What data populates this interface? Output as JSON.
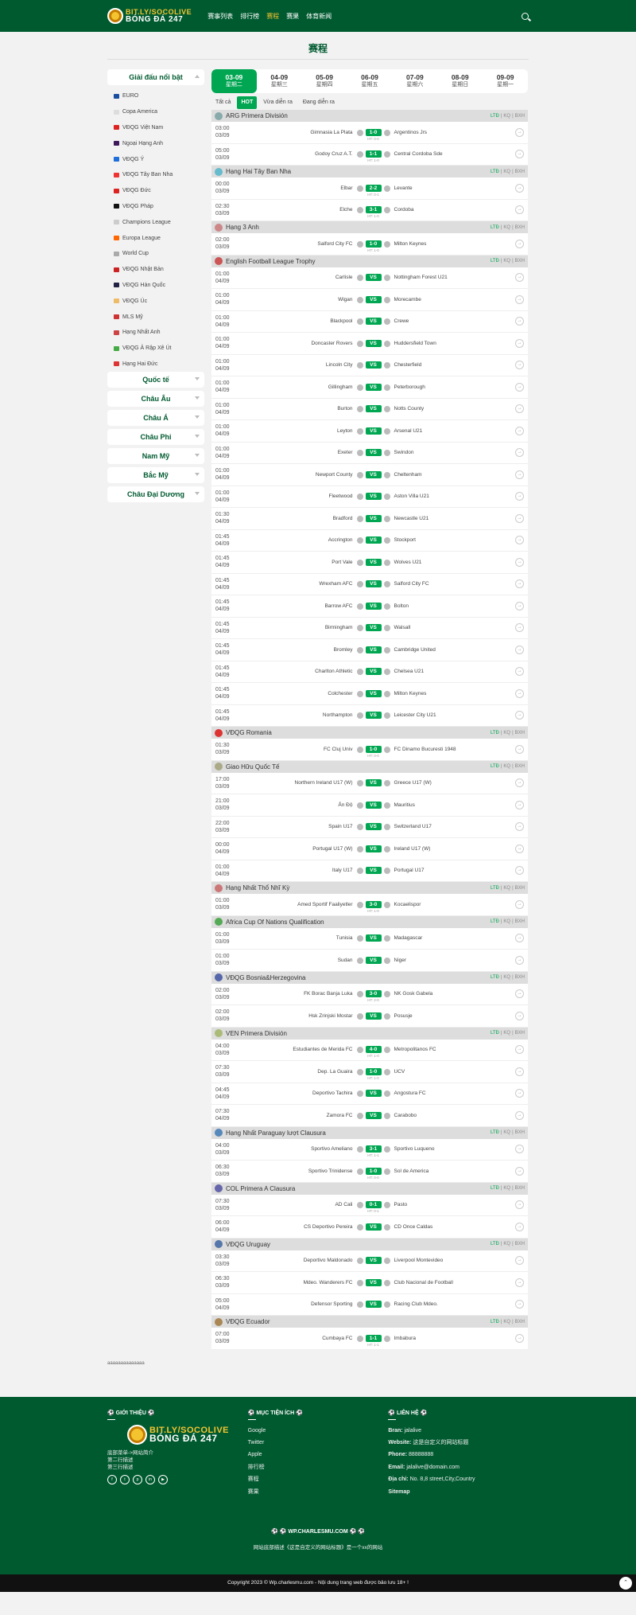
{
  "header": {
    "logo_top": "BIT.LY/SOCOLIVE",
    "logo_bottom": "BÓNG ĐÁ 247",
    "nav": [
      "赛事列表",
      "排行榜",
      "赛程",
      "赛果",
      "体育新闻"
    ],
    "nav_active": 2
  },
  "page_title": "赛程",
  "sidebar": {
    "featured_title": "Giải đấu nổi bật",
    "leagues": [
      "EURO",
      "Copa America",
      "VĐQG Việt Nam",
      "Ngoại Hạng Anh",
      "VĐQG Ý",
      "VĐQG Tây Ban Nha",
      "VĐQG Đức",
      "VĐQG Pháp",
      "Champions League",
      "Europa League",
      "World Cup",
      "VĐQG Nhật Bản",
      "VĐQG Hàn Quốc",
      "VĐQG Úc",
      "MLS Mỹ",
      "Hạng Nhất Anh",
      "VĐQG Ả Rập Xê Út",
      "Hạng Hai Đức"
    ],
    "regions": [
      "Quốc tế",
      "Châu Âu",
      "Châu Á",
      "Châu Phi",
      "Nam Mỹ",
      "Bắc Mỹ",
      "Châu Đại Dương"
    ]
  },
  "date_tabs": [
    {
      "d": "03-09",
      "w": "星期二"
    },
    {
      "d": "04-09",
      "w": "星期三"
    },
    {
      "d": "05-09",
      "w": "星期四"
    },
    {
      "d": "06-09",
      "w": "星期五"
    },
    {
      "d": "07-09",
      "w": "星期六"
    },
    {
      "d": "08-09",
      "w": "星期日"
    },
    {
      "d": "09-09",
      "w": "星期一"
    }
  ],
  "filter_tabs": [
    "Tất cả",
    "HOT",
    "Vừa diễn ra",
    "Đang diễn ra"
  ],
  "tags": [
    "LTĐ",
    "KQ",
    "BXH"
  ],
  "leagues": [
    {
      "name": "ARG Primera División",
      "color": "#8aa",
      "matches": [
        [
          "03:00",
          "03/09",
          "Gimnasia La Plata",
          "1-0",
          "HT: 0-0",
          "Argentinos Jrs"
        ],
        [
          "05:00",
          "03/09",
          "Godoy Cruz A.T.",
          "1-1",
          "HT: 1-0",
          "Central Cordoba Sde"
        ]
      ]
    },
    {
      "name": "Hạng Hai Tây Ban Nha",
      "color": "#6bc",
      "matches": [
        [
          "00:00",
          "03/09",
          "Elbar",
          "2-2",
          "HT: 0-1",
          "Levante"
        ],
        [
          "02:30",
          "03/09",
          "Elche",
          "3-1",
          "HT: 1-0",
          "Cordoba"
        ]
      ]
    },
    {
      "name": "Hạng 3 Anh",
      "color": "#c88",
      "matches": [
        [
          "02:00",
          "03/09",
          "Salford City FC",
          "1-0",
          "HT: 1-0",
          "Milton Keynes"
        ]
      ]
    },
    {
      "name": "English Football League Trophy",
      "color": "#c55",
      "matches": [
        [
          "01:00",
          "04/09",
          "Carlisle",
          "VS",
          "",
          "Nottingham Forest U21"
        ],
        [
          "01:00",
          "04/09",
          "Wigan",
          "VS",
          "",
          "Morecambe"
        ],
        [
          "01:00",
          "04/09",
          "Blackpool",
          "VS",
          "",
          "Crewe"
        ],
        [
          "01:00",
          "04/09",
          "Doncaster Rovers",
          "VS",
          "",
          "Huddersfield Town"
        ],
        [
          "01:00",
          "04/09",
          "Lincoln City",
          "VS",
          "",
          "Chesterfield"
        ],
        [
          "01:00",
          "04/09",
          "Gillingham",
          "VS",
          "",
          "Peterborough"
        ],
        [
          "01:00",
          "04/09",
          "Burton",
          "VS",
          "",
          "Notts County"
        ],
        [
          "01:00",
          "04/09",
          "Leyton",
          "VS",
          "",
          "Arsenal U21"
        ],
        [
          "01:00",
          "04/09",
          "Exeter",
          "VS",
          "",
          "Swindon"
        ],
        [
          "01:00",
          "04/09",
          "Newport County",
          "VS",
          "",
          "Cheltenham"
        ],
        [
          "01:00",
          "04/09",
          "Fleetwood",
          "VS",
          "",
          "Aston Villa U21"
        ],
        [
          "01:30",
          "04/09",
          "Bradford",
          "VS",
          "",
          "Newcastle U21"
        ],
        [
          "01:45",
          "04/09",
          "Accrington",
          "VS",
          "",
          "Stockport"
        ],
        [
          "01:45",
          "04/09",
          "Port Vale",
          "VS",
          "",
          "Wolves U21"
        ],
        [
          "01:45",
          "04/09",
          "Wrexham AFC",
          "VS",
          "",
          "Salford City FC"
        ],
        [
          "01:45",
          "04/09",
          "Barrow AFC",
          "VS",
          "",
          "Bolton"
        ],
        [
          "01:45",
          "04/09",
          "Birmingham",
          "VS",
          "",
          "Walsall"
        ],
        [
          "01:45",
          "04/09",
          "Bromley",
          "VS",
          "",
          "Cambridge United"
        ],
        [
          "01:45",
          "04/09",
          "Charlton Athletic",
          "VS",
          "",
          "Chelsea U21"
        ],
        [
          "01:45",
          "04/09",
          "Colchester",
          "VS",
          "",
          "Milton Keynes"
        ],
        [
          "01:45",
          "04/09",
          "Northampton",
          "VS",
          "",
          "Leicester City U21"
        ]
      ]
    },
    {
      "name": "VĐQG Romania",
      "color": "#d33",
      "matches": [
        [
          "01:30",
          "03/09",
          "FC Cluj Univ",
          "1-0",
          "HT: 0-0",
          "FC Dinamo Bucuresti 1948"
        ]
      ]
    },
    {
      "name": "Giao Hữu Quốc Tế",
      "color": "#aa8",
      "matches": [
        [
          "17:00",
          "03/09",
          "Northern Ireland U17 (W)",
          "VS",
          "",
          "Greece U17 (W)"
        ],
        [
          "21:00",
          "03/09",
          "Ấn Độ",
          "VS",
          "",
          "Mauritius"
        ],
        [
          "22:00",
          "03/09",
          "Spain U17",
          "VS",
          "",
          "Switzerland U17"
        ],
        [
          "00:00",
          "04/09",
          "Portugal U17 (W)",
          "VS",
          "",
          "Ireland U17 (W)"
        ],
        [
          "01:00",
          "04/09",
          "Italy U17",
          "VS",
          "",
          "Portugal U17"
        ]
      ]
    },
    {
      "name": "Hạng Nhất Thổ Nhĩ Kỳ",
      "color": "#c77",
      "matches": [
        [
          "01:00",
          "03/09",
          "Amed Sportif Faaliyetler",
          "3-0",
          "HT: 1-0",
          "Kocaelispor"
        ]
      ]
    },
    {
      "name": "Africa Cup Of Nations Qualification",
      "color": "#5a5",
      "matches": [
        [
          "01:00",
          "03/09",
          "Tunisia",
          "VS",
          "",
          "Madagascar"
        ],
        [
          "01:00",
          "03/09",
          "Sudan",
          "VS",
          "",
          "Niger"
        ]
      ]
    },
    {
      "name": "VĐQG Bosnia&Herzegovina",
      "color": "#56a",
      "matches": [
        [
          "02:00",
          "03/09",
          "FK Borac Banja Luka",
          "3-0",
          "HT: 2-0",
          "NK Gosk Gabela"
        ],
        [
          "02:00",
          "03/09",
          "Hsk Zrinjski Mostar",
          "VS",
          "",
          "Posusje"
        ]
      ]
    },
    {
      "name": "VEN Primera División",
      "color": "#ab7",
      "matches": [
        [
          "04:00",
          "03/09",
          "Estudiantes de Merida FC",
          "4-0",
          "HT: 1-0",
          "Metropolitanos FC"
        ],
        [
          "07:30",
          "03/09",
          "Dep. La Guaira",
          "1-0",
          "HT: 1-0",
          "UCV"
        ],
        [
          "04:45",
          "04/09",
          "Deportivo Tachira",
          "VS",
          "",
          "Angostura FC"
        ],
        [
          "07:30",
          "04/09",
          "Zamora FC",
          "VS",
          "",
          "Carabobo"
        ]
      ]
    },
    {
      "name": "Hạng Nhất Paraguay lượt Clausura",
      "color": "#58b",
      "matches": [
        [
          "04:00",
          "03/09",
          "Sportivo Ameliano",
          "3-1",
          "HT: 1-1",
          "Sportivo Luqueno"
        ],
        [
          "06:30",
          "03/09",
          "Sportivo Trinidense",
          "1-0",
          "HT: 0-0",
          "Sol de America"
        ]
      ]
    },
    {
      "name": "COL Primera A Clausura",
      "color": "#66a",
      "matches": [
        [
          "07:30",
          "03/09",
          "AD Cali",
          "0-1",
          "HT: 0-1",
          "Pasto"
        ],
        [
          "06:00",
          "04/09",
          "CS Deportivo Pereira",
          "VS",
          "",
          "CD Once Caldas"
        ]
      ]
    },
    {
      "name": "VĐQG Uruguay",
      "color": "#57a",
      "matches": [
        [
          "03:30",
          "03/09",
          "Deportivo Maldonado",
          "VS",
          "",
          "Liverpool Montevideo"
        ],
        [
          "06:30",
          "03/09",
          "Mdeo. Wanderers FC",
          "VS",
          "",
          "Club Nacional de Football"
        ],
        [
          "05:00",
          "04/09",
          "Defensor Sporting",
          "VS",
          "",
          "Racing Club Mdeo."
        ]
      ]
    },
    {
      "name": "VĐQG Ecuador",
      "color": "#a85",
      "matches": [
        [
          "07:00",
          "03/09",
          "Cumbaya FC",
          "1-1",
          "HT: 1-1",
          "Imbabura"
        ]
      ]
    }
  ],
  "misc_text": "aaaaaaaaaaaaaa",
  "footer": {
    "intro_title": "⚽ GIỚI THIỆU ⚽",
    "intro_lines": [
      "底部菜单->网站简介",
      "第二行描述",
      "第三行描述"
    ],
    "links_title": "⚽ MỤC TIỆN ÍCH ⚽",
    "links": [
      "Google",
      "Twitter",
      "Apple",
      "排行榜",
      "赛程",
      "赛果"
    ],
    "contact_title": "⚽ LIÊN HỆ ⚽",
    "contact": [
      [
        "Bran:",
        "jalalive"
      ],
      [
        "Website:",
        "这是自定义的网站标题"
      ],
      [
        "Phone:",
        "88888888"
      ],
      [
        "Email:",
        "jalalive@domain.com"
      ],
      [
        "Địa chỉ:",
        "No. 8,8 street,City,Country"
      ],
      [
        "Sitemap",
        ""
      ]
    ],
    "center_title": "⚽ ⚽ WP.CHARLESMU.COM ⚽ ⚽",
    "center_sub": "网站底部描述《这是自定义的网站标题》是一个xx的网站",
    "copyright": "Copyright 2023 © Wp.charlesmu.com - Nội dung trang web được bảo lưu 18+ !"
  }
}
